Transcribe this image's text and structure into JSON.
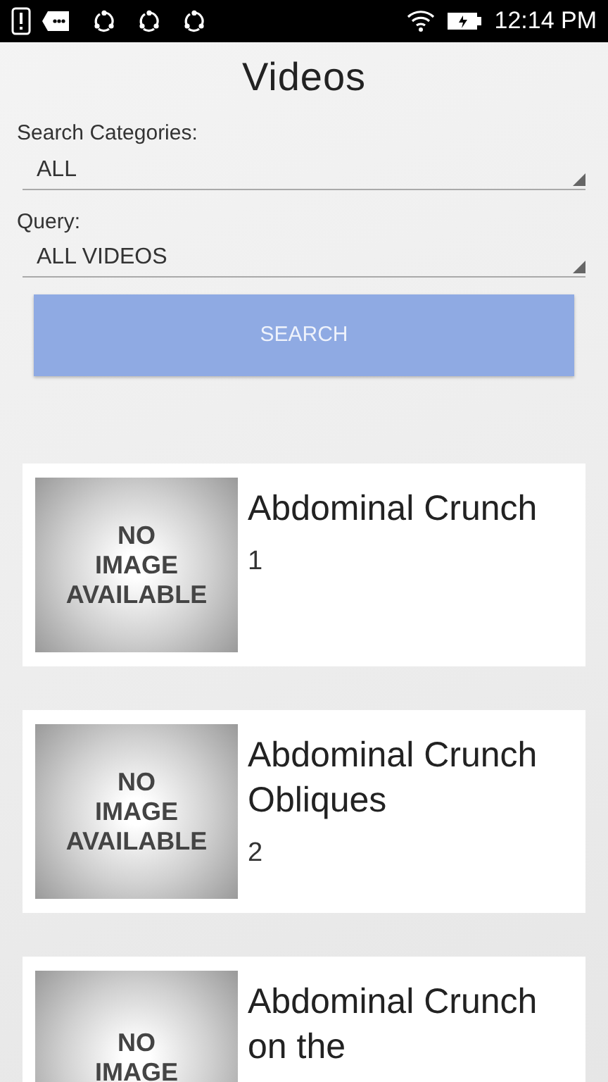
{
  "status_bar": {
    "time": "12:14 PM"
  },
  "title": "Videos",
  "filters": [
    {
      "label": "Search Categories:",
      "value": "ALL"
    },
    {
      "label": "Query:",
      "value": "ALL VIDEOS"
    }
  ],
  "search_button": "SEARCH",
  "videos": [
    {
      "thumbnail_text": [
        "NO",
        "IMAGE",
        "AVAILABLE"
      ],
      "title": "Abdominal Crunch",
      "number": "1"
    },
    {
      "thumbnail_text": [
        "NO",
        "IMAGE",
        "AVAILABLE"
      ],
      "title": "Abdominal Crunch Obliques",
      "number": "2"
    },
    {
      "thumbnail_text": [
        "NO",
        "IMAGE"
      ],
      "title": "Abdominal Crunch on the"
    }
  ]
}
